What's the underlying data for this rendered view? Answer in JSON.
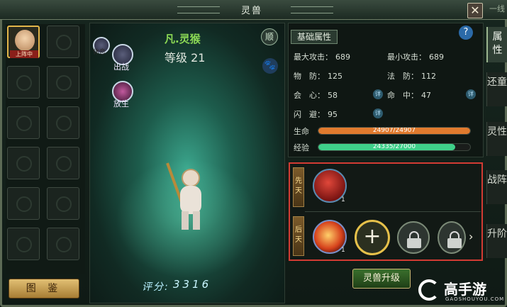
{
  "window": {
    "title": "灵兽",
    "close_icon": "close-icon",
    "corner_text": "一线"
  },
  "sidebar_slots": {
    "active_badge": "上阵中",
    "tujian_label": "图 鉴"
  },
  "stage": {
    "pet_name": "凡.灵猴",
    "level_text": "等级 21",
    "tag_top": "休息",
    "action_fight": "出战",
    "action_release": "放生",
    "shun_label": "顺",
    "score_label": "评分:",
    "score_value": "3316"
  },
  "attributes": {
    "tab_label": "基础属性",
    "help_icon": "?",
    "max_attack": {
      "label": "最大攻击：",
      "value": "689"
    },
    "min_attack": {
      "label": "最小攻击：",
      "value": "689"
    },
    "phys_def": {
      "label": "物　防：",
      "value": "125"
    },
    "magic_def": {
      "label": "法　防：",
      "value": "112"
    },
    "crit": {
      "label": "会　心：",
      "value": "58"
    },
    "hit": {
      "label": "命　中：",
      "value": "47"
    },
    "dodge": {
      "label": "闪　避：",
      "value": "95"
    },
    "hp": {
      "label": "生命",
      "text": "24907/24907",
      "current": 24907,
      "max": 24907,
      "color": "#e07a2e"
    },
    "exp": {
      "label": "经验",
      "text": "24335/27000",
      "current": 24335,
      "max": 27000,
      "color": "#3fd08a"
    }
  },
  "skills": {
    "innate_tag": "先天",
    "acquired_tag": "后天",
    "innate_count": "1",
    "acquired_count": "1",
    "add_icon": "+",
    "more_icon": "›"
  },
  "upgrade_button": "灵兽升级",
  "side_tabs": [
    "属性",
    "还童",
    "灵性",
    "战阵",
    "升阶"
  ],
  "watermark": {
    "brand": "高手游",
    "url": "GAOSHOUYOU.COM"
  }
}
